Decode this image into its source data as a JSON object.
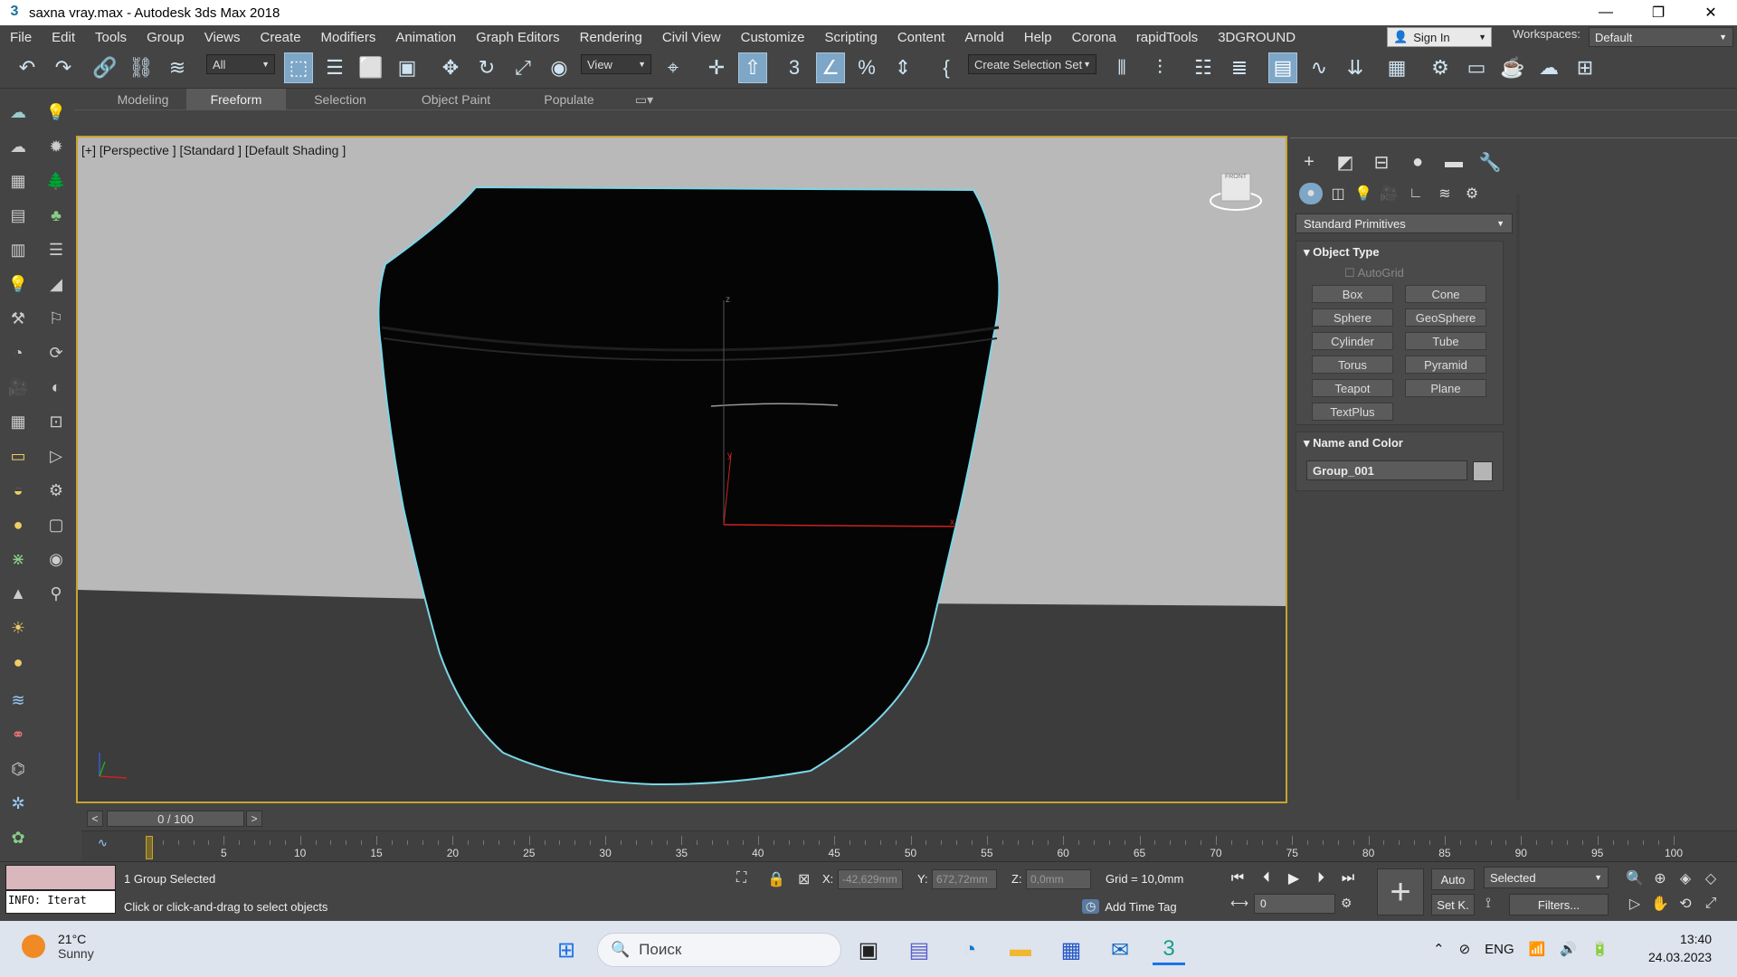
{
  "window": {
    "title": "saxna vray.max - Autodesk 3ds Max 2018",
    "app_icon": "3ds-max-icon",
    "controls": [
      "—",
      "❐",
      "✕"
    ]
  },
  "menu": [
    "File",
    "Edit",
    "Tools",
    "Group",
    "Views",
    "Create",
    "Modifiers",
    "Animation",
    "Graph Editors",
    "Rendering",
    "Civil View",
    "Customize",
    "Scripting",
    "Content",
    "Arnold",
    "Help",
    "Corona",
    "rapidTools",
    "3DGROUND"
  ],
  "account": {
    "sign_in": "Sign In",
    "workspaces_label": "Workspaces:",
    "workspace": "Default"
  },
  "toolbar": {
    "selection_filter": "All",
    "ref_coord": "View",
    "selection_set": "Create Selection Set"
  },
  "ribbon_tabs": [
    "Modeling",
    "Freeform",
    "Selection",
    "Object Paint",
    "Populate"
  ],
  "ribbon_active": "Freeform",
  "viewport": {
    "label": "[+] [Perspective ] [Standard ] [Default Shading ]",
    "viewcube": "FRONT",
    "colors": {
      "background": "#b9b9b9",
      "floor": "#3c3c3c",
      "object": "#050505",
      "selection_outline": "#7ad7e8",
      "border": "#c6a42f"
    }
  },
  "command_panel": {
    "category": "Standard Primitives",
    "object_type": {
      "title": "Object Type",
      "autogrid": "AutoGrid",
      "buttons": [
        "Box",
        "Cone",
        "Sphere",
        "GeoSphere",
        "Cylinder",
        "Tube",
        "Torus",
        "Pyramid",
        "Teapot",
        "Plane",
        "TextPlus"
      ]
    },
    "name_and_color": {
      "title": "Name and Color",
      "object_name": "Group_001",
      "color": "#b5b5b5"
    }
  },
  "timeline": {
    "slider": "0 / 100",
    "ticks": [
      5,
      10,
      15,
      20,
      25,
      30,
      35,
      40,
      45,
      50,
      55,
      60,
      65,
      70,
      75,
      80,
      85,
      90,
      95,
      100
    ],
    "start": 0,
    "end": 100
  },
  "status": {
    "maxscript": "INFO: Iterat",
    "selection": "1 Group Selected",
    "prompt": "Click or click-and-drag to select objects",
    "x_label": "X:",
    "x": "-42,629mm",
    "y_label": "Y:",
    "y": "672,72mm",
    "z_label": "Z:",
    "z": "0,0mm",
    "grid": "Grid = 10,0mm",
    "add_time_tag": "Add Time Tag",
    "auto": "Auto",
    "set_key": "Set K.",
    "key_filter": "Selected",
    "filters": "Filters...",
    "frame": "0"
  },
  "taskbar": {
    "temp": "21°C",
    "weather": "Sunny",
    "search": "Поиск",
    "lang": "ENG",
    "time": "13:40",
    "date": "24.03.2023"
  }
}
